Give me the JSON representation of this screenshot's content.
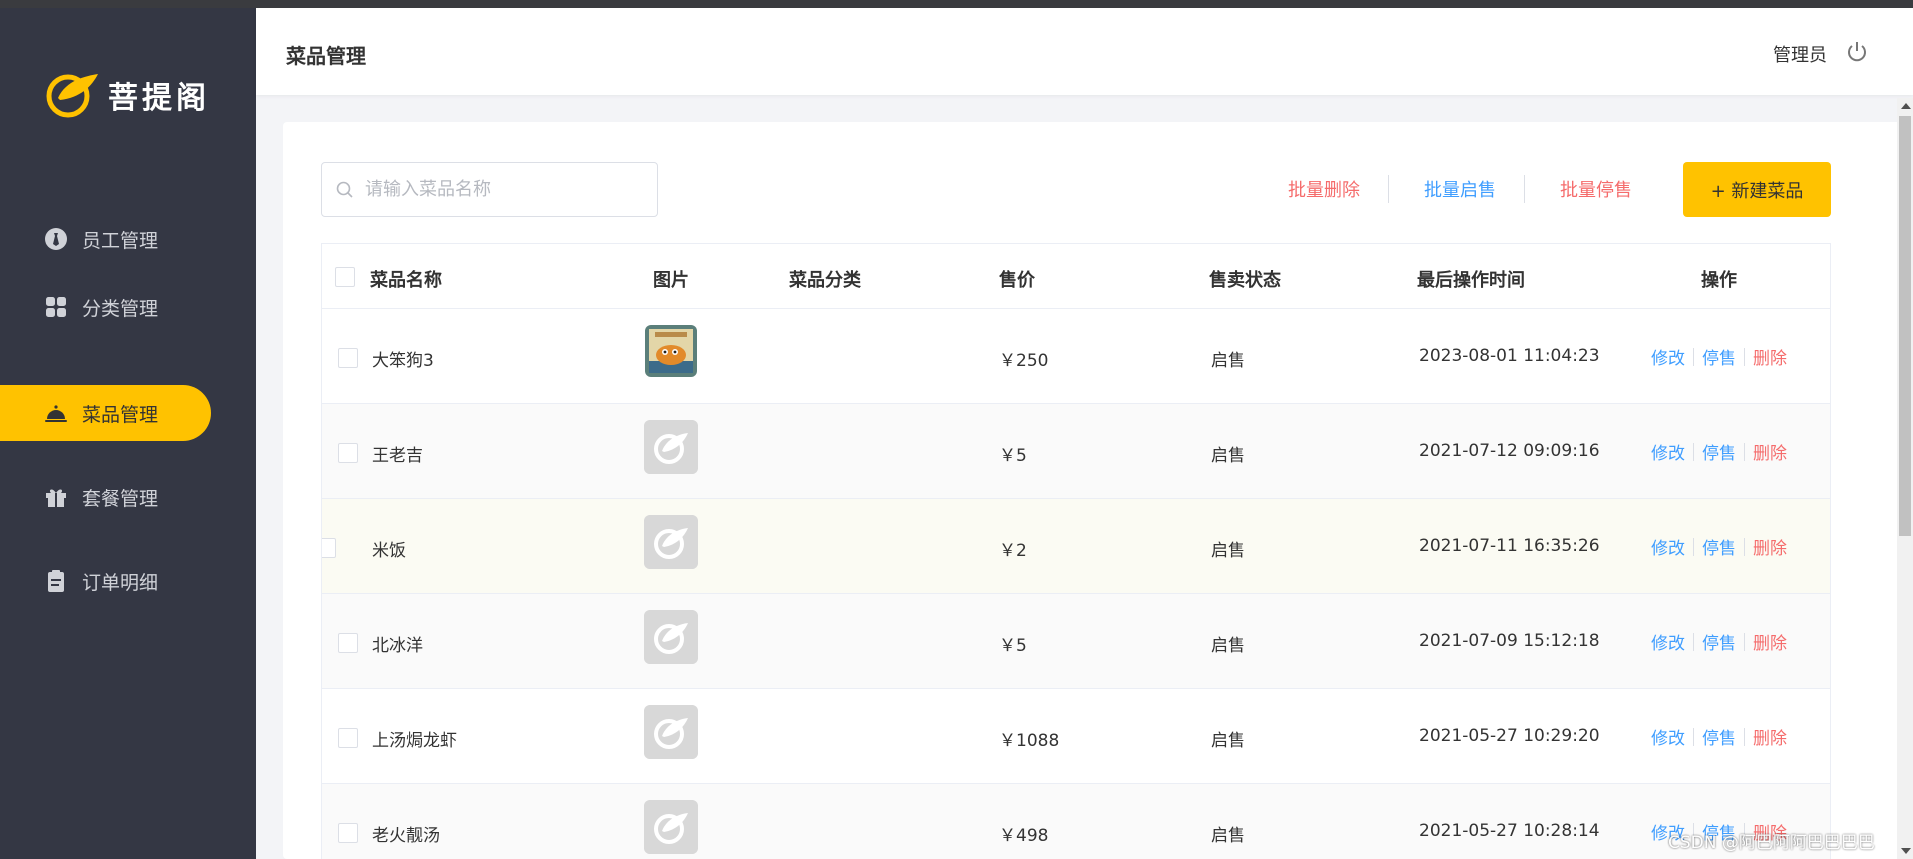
{
  "brand": {
    "name": "菩提阁",
    "accent": "#ffc200",
    "sidebar_bg": "#343744"
  },
  "sidebar": {
    "items": [
      {
        "label": "员工管理",
        "icon": "employee-icon",
        "active": false
      },
      {
        "label": "分类管理",
        "icon": "category-grid-icon",
        "active": false
      },
      {
        "label": "菜品管理",
        "icon": "dish-cloche-icon",
        "active": true
      },
      {
        "label": "套餐管理",
        "icon": "gift-icon",
        "active": false
      },
      {
        "label": "订单明细",
        "icon": "clipboard-icon",
        "active": false
      }
    ]
  },
  "header": {
    "title": "菜品管理",
    "user": "管理员",
    "logout_icon": "power-icon"
  },
  "toolbar": {
    "search_placeholder": "请输入菜品名称",
    "batch_delete": "批量删除",
    "batch_enable": "批量启售",
    "batch_disable": "批量停售",
    "new_button": "+ 新建菜品"
  },
  "table": {
    "columns": [
      "菜品名称",
      "图片",
      "菜品分类",
      "售价",
      "售卖状态",
      "最后操作时间",
      "操作"
    ],
    "rows": [
      {
        "name": "大笨狗3",
        "image": "photo",
        "category": "",
        "price": "￥250",
        "status": "启售",
        "time": "2023-08-01 11:04:23"
      },
      {
        "name": "王老吉",
        "image": "placeholder",
        "category": "",
        "price": "￥5",
        "status": "启售",
        "time": "2021-07-12 09:09:16"
      },
      {
        "name": "米饭",
        "image": "placeholder",
        "category": "",
        "price": "￥2",
        "status": "启售",
        "time": "2021-07-11 16:35:26"
      },
      {
        "name": "北冰洋",
        "image": "placeholder",
        "category": "",
        "price": "￥5",
        "status": "启售",
        "time": "2021-07-09 15:12:18"
      },
      {
        "name": "上汤焗龙虾",
        "image": "placeholder",
        "category": "",
        "price": "￥1088",
        "status": "启售",
        "time": "2021-05-27 10:29:20"
      },
      {
        "name": "老火靓汤",
        "image": "placeholder",
        "category": "",
        "price": "￥498",
        "status": "启售",
        "time": "2021-05-27 10:28:14"
      }
    ],
    "actions": {
      "edit": "修改",
      "disable": "停售",
      "delete": "删除"
    }
  },
  "watermark": "CSDN @阿巴阿阿巴巴巴巴"
}
